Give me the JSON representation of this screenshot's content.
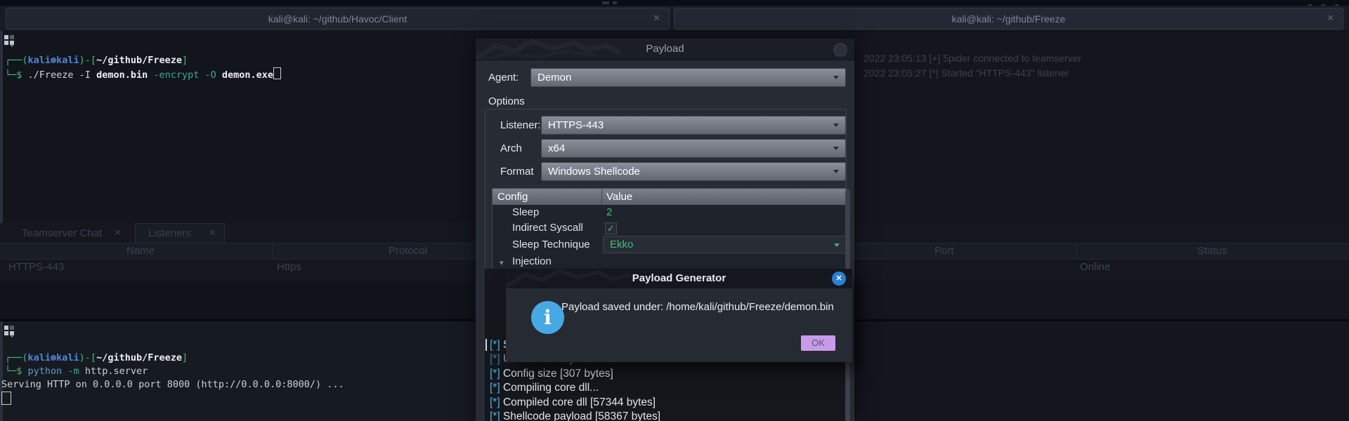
{
  "glyphs": {
    "close_x": "✕",
    "tab_close": "✕",
    "check": "✓",
    "expand_arrow": "▾",
    "info": "i",
    "console_cursor": "|"
  },
  "colors": {
    "accent_green": "#41bd78",
    "prompt_blue": "#4d86d8",
    "console_cyan": "#55aee0",
    "ok_purple": "#c79bea",
    "info_blue": "#47a9e3",
    "close_blue": "#2b7fd4"
  },
  "window_tabs": {
    "left": "kali@kali: ~/github/Havoc/Client",
    "right": "kali@kali: ~/github/Freeze"
  },
  "terminal_top": {
    "prompt": {
      "open": "┌──(",
      "user": "kali⊛kali",
      "mid": ")-[",
      "path": "~/github/Freeze",
      "close": "]"
    },
    "line2": {
      "dollar": "└─$",
      "cmd": " ./Freeze -I ",
      "file1": "demon.bin",
      "opt1": " -encrypt",
      "opt2": " -O ",
      "file2": "demon.exe"
    }
  },
  "terminal_bottom": {
    "prompt": {
      "open": "┌──(",
      "user": "kali⊛kali",
      "mid": ")-[",
      "path": "~/github/Freeze",
      "close": "]"
    },
    "line2": {
      "dollar": "└─$",
      "cmd": " python",
      "opt": " -m",
      "arg": " http.server"
    },
    "line3": "Serving HTTP on 0.0.0.0 port 8000 (http://0.0.0.0:8000/) ..."
  },
  "havoc_bg": {
    "log_lines": [
      "2022 23:05:13 [+] 5pider connected to teamserver",
      "2022 23:05:27 [*] Started \"HTTPS-443\" listener"
    ],
    "chat_tab": "Teamserver Chat",
    "listeners_tab": "Listeners",
    "headers": {
      "name": "Name",
      "protocol": "Protocol",
      "port": "Port",
      "status": "Status"
    },
    "listener_row": {
      "name": "HTTPS-443",
      "protocol": "Https",
      "status": "Online"
    }
  },
  "payload_window": {
    "title": "Payload",
    "agent_label": "Agent:",
    "agent_value": "Demon",
    "options_label": "Options",
    "listener_label": "Listener:",
    "listener_value": "HTTPS-443",
    "arch_label": "Arch",
    "arch_value": "x64",
    "format_label": "Format",
    "format_value": "Windows Shellcode",
    "config": {
      "header": {
        "config": "Config",
        "value": "Value"
      },
      "rows": [
        {
          "label": "Sleep",
          "value": "2"
        },
        {
          "label": "Indirect Syscall",
          "value": "✓"
        },
        {
          "label": "Sleep Technique",
          "value": "Ekko"
        },
        {
          "label": "Injection",
          "value": ""
        }
      ]
    },
    "console": {
      "lines": [
        {
          "prefix": "[*]",
          "text": "S"
        },
        {
          "prefix": "[*]",
          "text": "Use indirect syscalls"
        },
        {
          "prefix": "[*]",
          "text": "Config size [307 bytes]"
        },
        {
          "prefix": "[*]",
          "text": "Compiling core dll..."
        },
        {
          "prefix": "[*]",
          "text": "Compiled core dll [57344 bytes]"
        },
        {
          "prefix": "[*]",
          "text": "Shellcode payload [58367 bytes]"
        }
      ]
    }
  },
  "dialog": {
    "title": "Payload Generator",
    "message": "Payload saved under: /home/kali/github/Freeze/demon.bin",
    "ok_label": "OK"
  }
}
